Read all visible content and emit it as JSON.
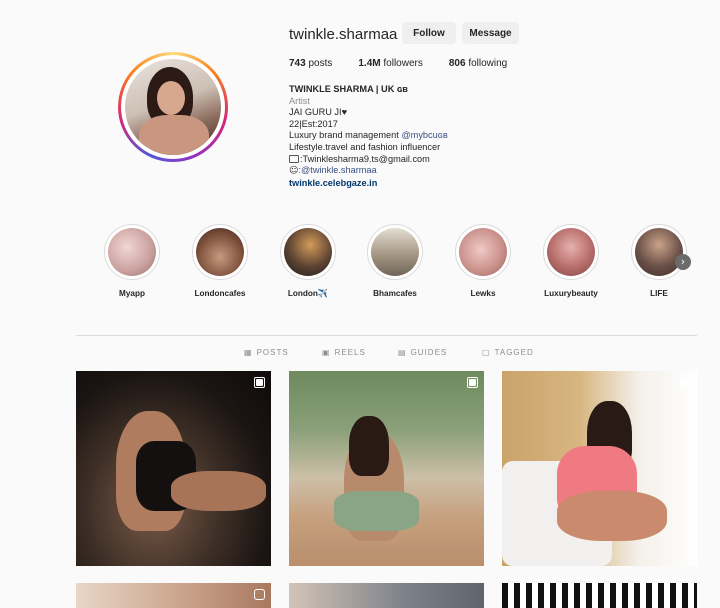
{
  "profile": {
    "username": "twinkle.sharmaa",
    "follow_label": "Follow",
    "message_label": "Message",
    "stats": {
      "posts_count": "743",
      "posts_label": "posts",
      "followers_count": "1.4M",
      "followers_label": "followers",
      "following_count": "806",
      "following_label": "following"
    },
    "bio": {
      "name": "TWINKLE SHARMA | UK ɢʙ",
      "category": "Artist",
      "line1": "JAI GURU JI♥",
      "line2": "22|Est:2017",
      "line3_text": "Luxury brand management ",
      "line3_mention": "@mybcuɢʙ",
      "line4": "Lifestyle.travel and fashion influencer",
      "email": ":Twinklesharma9.ts@gmail.com",
      "handle": ":@twinkle.sharmaa",
      "website": "twinkle.celebgaze.in"
    }
  },
  "highlights": [
    {
      "label": "Myapp",
      "color": "#d9b9b8"
    },
    {
      "label": "Londoncafes",
      "color": "#8b5a44"
    },
    {
      "label": "London✈️",
      "color": "#5b4434"
    },
    {
      "label": "Bhamcafes",
      "color": "#a89a86"
    },
    {
      "label": "Lewks",
      "color": "#d7a9a5"
    },
    {
      "label": "Luxurybeauty",
      "color": "#c98f8b"
    },
    {
      "label": "LIFE",
      "color": "#6b5148"
    }
  ],
  "tabs": {
    "posts": "POSTS",
    "reels": "REELS",
    "guides": "GUIDES",
    "tagged": "TAGGED"
  },
  "icons": {
    "grid": "grid-icon",
    "reels": "reels-icon",
    "guides": "guides-icon",
    "tagged": "tagged-icon",
    "next": "chevron-right-icon"
  }
}
